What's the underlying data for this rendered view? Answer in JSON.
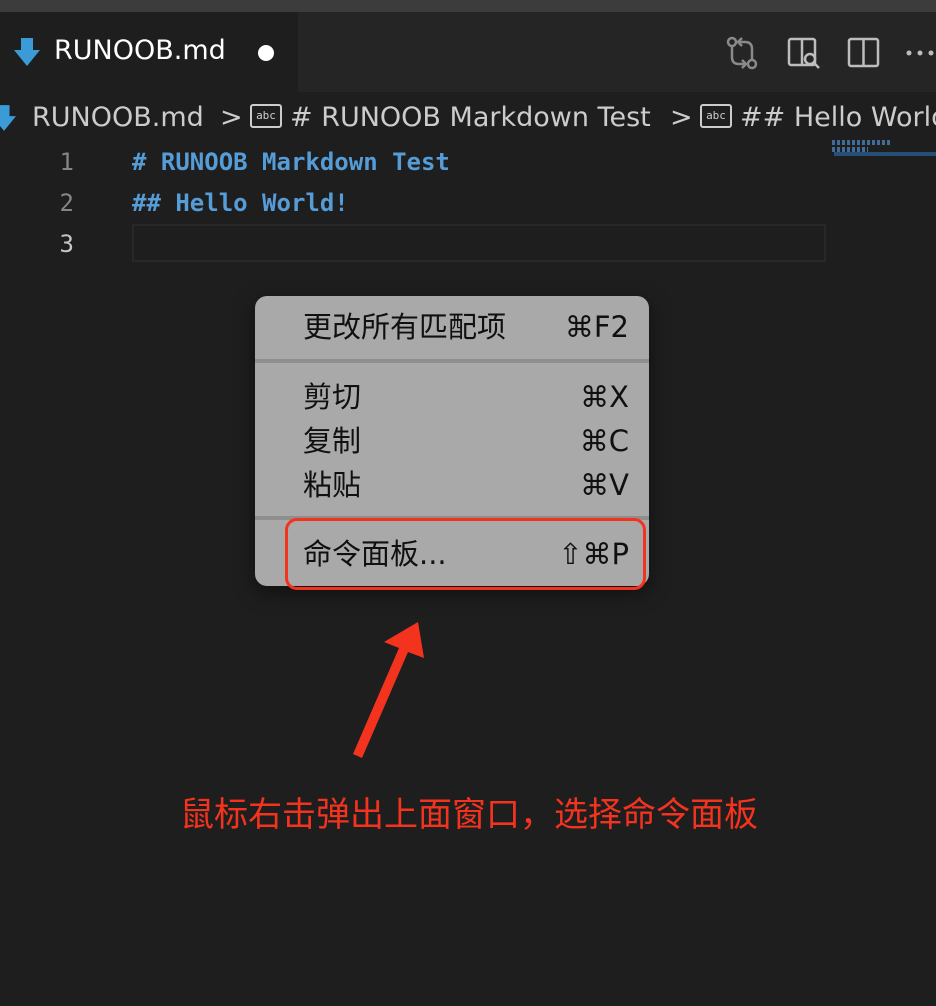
{
  "tab": {
    "title": "RUNOOB.md",
    "dirty": true
  },
  "breadcrumb": {
    "file": "RUNOOB.md",
    "separator": ">",
    "symbol_icon_text": "abc",
    "items": [
      "# RUNOOB Markdown Test",
      "## Hello World"
    ]
  },
  "editor": {
    "lines": [
      {
        "number": "1",
        "text": "# RUNOOB Markdown Test"
      },
      {
        "number": "2",
        "text": "## Hello World!"
      },
      {
        "number": "3",
        "text": ""
      }
    ],
    "active_line": "3"
  },
  "context_menu": {
    "items": [
      {
        "label": "更改所有匹配项",
        "shortcut": "⌘F2"
      },
      {
        "label": "剪切",
        "shortcut": "⌘X"
      },
      {
        "label": "复制",
        "shortcut": "⌘C"
      },
      {
        "label": "粘贴",
        "shortcut": "⌘V"
      },
      {
        "label": "命令面板...",
        "shortcut": "⇧⌘P"
      }
    ]
  },
  "annotation": {
    "text": "鼠标右击弹出上面窗口，选择命令面板",
    "color": "#f4331f"
  },
  "colors": {
    "markdown_icon": "#3b9bd6",
    "heading_text": "#569cd6",
    "annotation_red": "#f4331f"
  },
  "icons": {
    "tab_icon": "markdown-arrow-icon",
    "actions": [
      "compare-changes-icon",
      "open-preview-icon",
      "split-editor-icon",
      "more-actions-icon"
    ]
  }
}
